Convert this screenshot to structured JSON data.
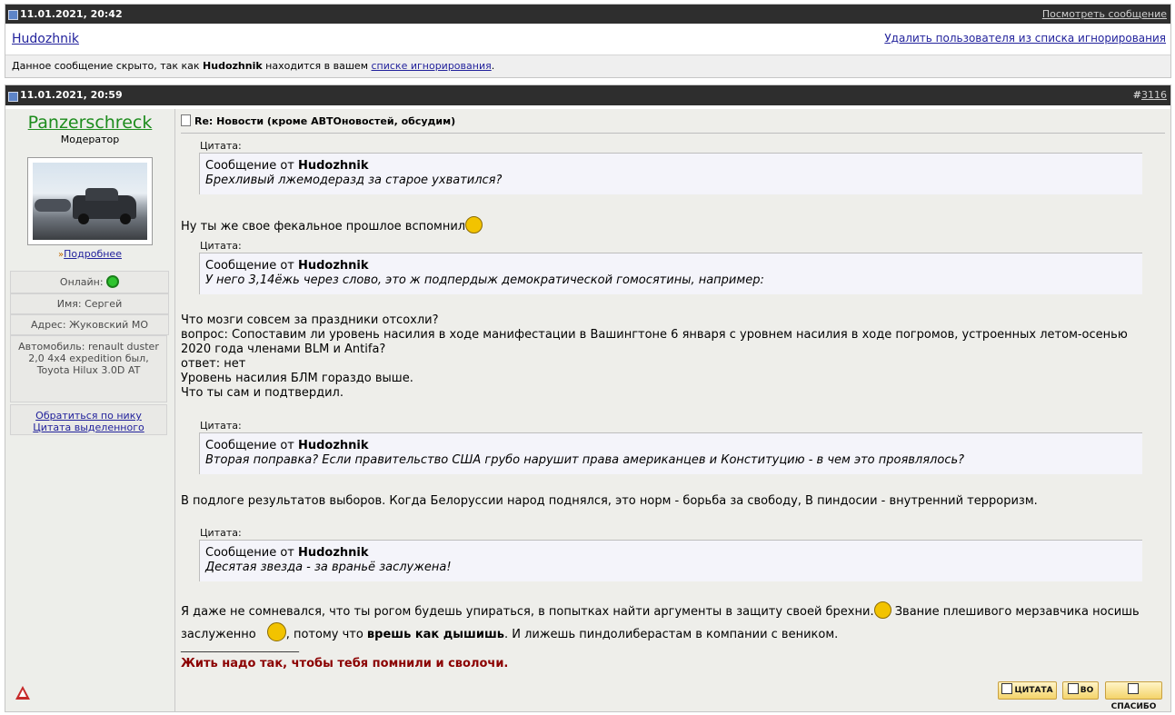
{
  "hidden_post": {
    "date": "11.01.2021, 20:42",
    "view_link": "Посмотреть сообщение",
    "username": "Hudozhnik",
    "remove_ignore_link": "Удалить пользователя из списка игнорирования",
    "notice_prefix": "Данное сообщение скрыто, так как ",
    "notice_user": "Hudozhnik",
    "notice_middle": " находится в вашем ",
    "notice_link": "списке игнорирования",
    "notice_suffix": "."
  },
  "post": {
    "date": "11.01.2021, 20:59",
    "number_prefix": "#",
    "number": "3116",
    "title_prefix": "Re: ",
    "title": "Новости (кроме АВТОновостей, обсудим)",
    "author": {
      "name": "Panzerschreck",
      "rank": "Модератор",
      "more_link": "Подробнее",
      "online_label": "Онлайн:",
      "name_field": "Имя: Сергей",
      "address_field": "Адрес: Жуковский МО",
      "car_field_lines": [
        "Автомобиль: renault duster",
        "2,0 4x4 expedition был,",
        "Toyota Hilux 3.0D AT"
      ],
      "action_nick": "Обратиться по нику",
      "action_quote": "Цитата выделенного"
    },
    "quote_label": "Цитата:",
    "quote_from": "Сообщение от ",
    "quotes": [
      {
        "user": "Hudozhnik",
        "text": "Брехливый лжемодеразд за старое ухватился?"
      },
      {
        "user": "Hudozhnik",
        "text": "У него 3,14ёжь через слово, это ж подпердыж демократической гомосятины, например:"
      },
      {
        "user": "Hudozhnik",
        "text": "Вторая поправка? Если правительство США грубо нарушит права американцев и Конституцию - в чем это проявлялось?"
      },
      {
        "user": "Hudozhnik",
        "text": "Десятая звезда - за враньё заслужена!"
      }
    ],
    "reply1": "Ну ты же свое фекальное прошлое вспомнил",
    "reply2_lines": [
      "Что мозги совсем за праздники отсохли?",
      "вопрос: Сопоставим ли уровень насилия в ходе манифестации в Вашингтоне 6 января с уровнем насилия в ходе погромов, устроенных летом-осенью",
      "2020 года членами BLM и Antifa?",
      "ответ: нет",
      "Уровень насилия БЛМ гораздо выше.",
      "Что ты сам и подтвердил."
    ],
    "reply3": "В подлоге результатов выборов. Когда Белоруссии народ поднялся, это норм - борьба за свободу, В пиндосии - внутренний терроризм.",
    "reply4_a": "Я даже не сомневался, что ты рогом будешь упираться, в попытках найти аргументы в защиту своей брехни.",
    "reply4_b": " Звание плешивого мерзавчика носишь",
    "reply4_c": "заслуженно",
    "reply4_d": ", потому что ",
    "reply4_bold": "врешь как дышишь",
    "reply4_e": ". И лижешь пиндолиберастам в компании с веником.",
    "signature_line": "____________________",
    "signature": "Жить надо так, чтобы тебя помнили и сволочи.",
    "buttons": {
      "quote": "ЦИТАТА",
      "to": "ВО",
      "thanks": "СПАСИБО"
    }
  },
  "colors": {
    "header_bg": "#2e2e2e",
    "username_green": "#1d8c1d",
    "signature_red": "#8b0000",
    "link_blue": "#22229c"
  }
}
